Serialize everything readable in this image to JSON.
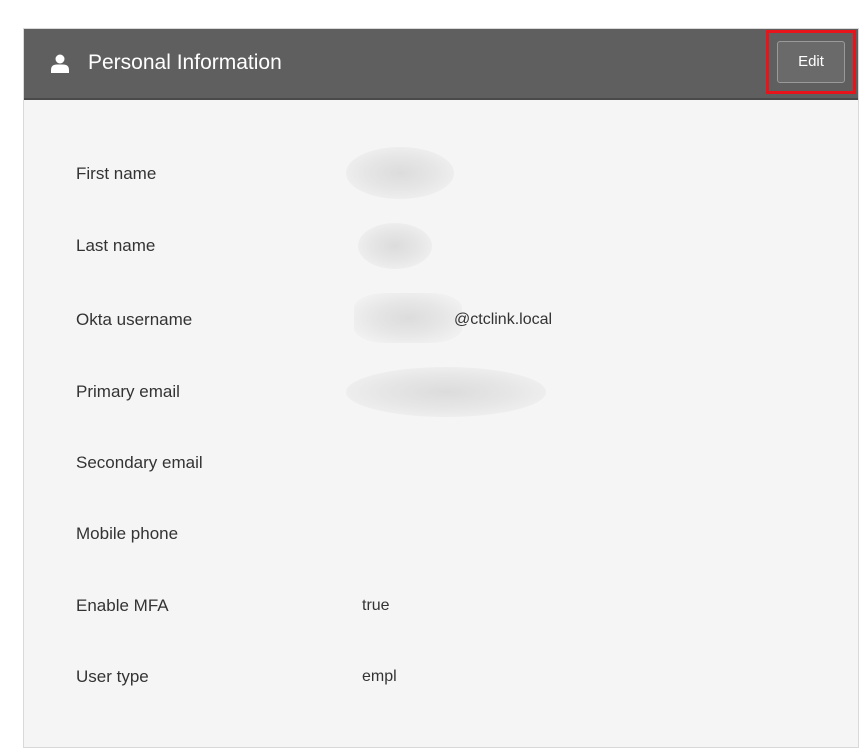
{
  "panel": {
    "title": "Personal Information",
    "edit_label": "Edit",
    "header_icon": "user-icon"
  },
  "fields": {
    "first_name": {
      "label": "First name",
      "value": ""
    },
    "last_name": {
      "label": "Last name",
      "value": ""
    },
    "okta_username": {
      "label": "Okta username",
      "value": "@ctclink.local"
    },
    "primary_email": {
      "label": "Primary email",
      "value": ""
    },
    "secondary_email": {
      "label": "Secondary email",
      "value": ""
    },
    "mobile_phone": {
      "label": "Mobile phone",
      "value": ""
    },
    "enable_mfa": {
      "label": "Enable MFA",
      "value": "true"
    },
    "user_type": {
      "label": "User type",
      "value": "empl"
    }
  },
  "colors": {
    "header_bg": "#5f5f5f",
    "panel_bg": "#f5f5f5",
    "highlight": "#e8141b"
  }
}
